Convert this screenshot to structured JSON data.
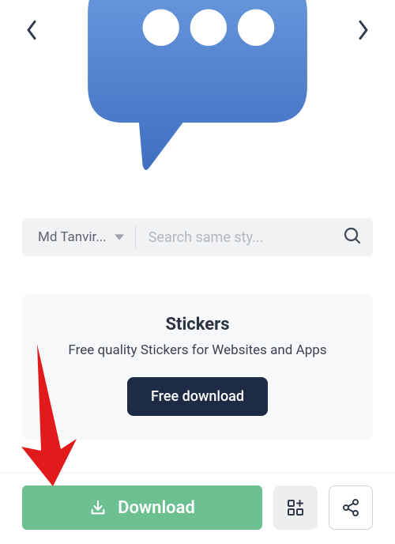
{
  "author": {
    "name": "Md Tanvir..."
  },
  "search": {
    "placeholder": "Search same sty..."
  },
  "promo": {
    "title": "Stickers",
    "subtitle": "Free quality Stickers for Websites and Apps",
    "button": "Free download"
  },
  "download": {
    "label": "Download"
  }
}
